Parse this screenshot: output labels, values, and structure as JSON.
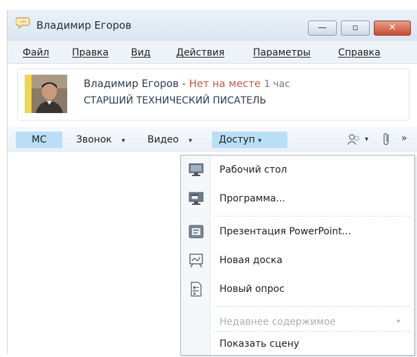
{
  "window": {
    "title": "Владимир Егоров",
    "controls": {
      "minimize": "—",
      "maximize": "▫",
      "close": "✕"
    }
  },
  "menubar": {
    "items": [
      "Файл",
      "Правка",
      "Вид",
      "Действия",
      "Параметры",
      "Справка"
    ]
  },
  "contact": {
    "name": "Владимир Егоров",
    "separator": "-",
    "status": "Нет на месте",
    "status_time": "1 час",
    "job_title": "СТАРШИЙ ТЕХНИЧЕСКИЙ ПИСАТЕЛЬ",
    "status_color": "#c25a3c"
  },
  "toolbar": {
    "im_label": "МС",
    "call_label": "Звонок",
    "video_label": "Видео",
    "share_label": "Доступ",
    "caret": "▾",
    "overflow": "»",
    "accent": "#b9dff6"
  },
  "share_menu": {
    "items": [
      {
        "label": "Рабочий стол",
        "icon": "desktop-icon"
      },
      {
        "label": "Программа...",
        "icon": "program-icon"
      },
      {
        "label": "Презентация PowerPoint...",
        "icon": "powerpoint-icon"
      },
      {
        "label": "Новая доска",
        "icon": "whiteboard-icon"
      },
      {
        "label": "Новый опрос",
        "icon": "poll-icon"
      }
    ],
    "recent_content": "Недавнее содержимое",
    "recent_arrow": "▸",
    "show_stage": "Показать сцену"
  }
}
